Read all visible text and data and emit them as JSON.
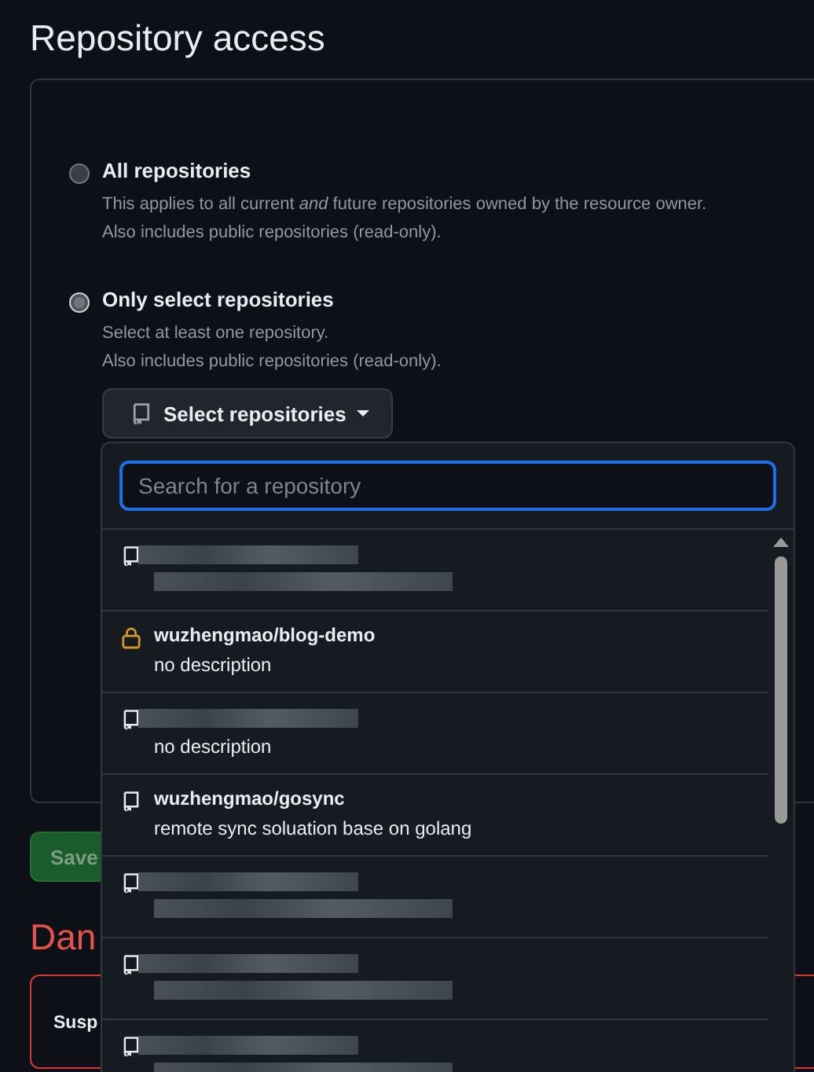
{
  "section_title": "Repository access",
  "options": [
    {
      "label": "All repositories",
      "selected": false,
      "description": "This applies to all current *and* future repositories owned by the resource owner.",
      "note": "Also includes public repositories (read-only)."
    },
    {
      "label": "Only select repositories",
      "selected": true,
      "description": "Select at least one repository.",
      "note": "Also includes public repositories (read-only)."
    }
  ],
  "select_button": {
    "label": "Select repositories"
  },
  "save_button": {
    "label": "Save"
  },
  "danger_title": "Dan",
  "danger_item": "Susp",
  "dropdown": {
    "search": {
      "placeholder": "Search for a repository"
    },
    "repositories": [
      {
        "kind": "public",
        "redacted": true
      },
      {
        "kind": "private",
        "redacted": false,
        "name": "wuzhengmao/blog-demo",
        "description": "no description"
      },
      {
        "kind": "public",
        "redacted": true,
        "description": "no description"
      },
      {
        "kind": "public",
        "redacted": false,
        "name": "wuzhengmao/gosync",
        "description": "remote sync soluation base on golang"
      },
      {
        "kind": "public",
        "redacted": true
      },
      {
        "kind": "public",
        "redacted": true
      },
      {
        "kind": "public",
        "redacted": true
      }
    ]
  }
}
